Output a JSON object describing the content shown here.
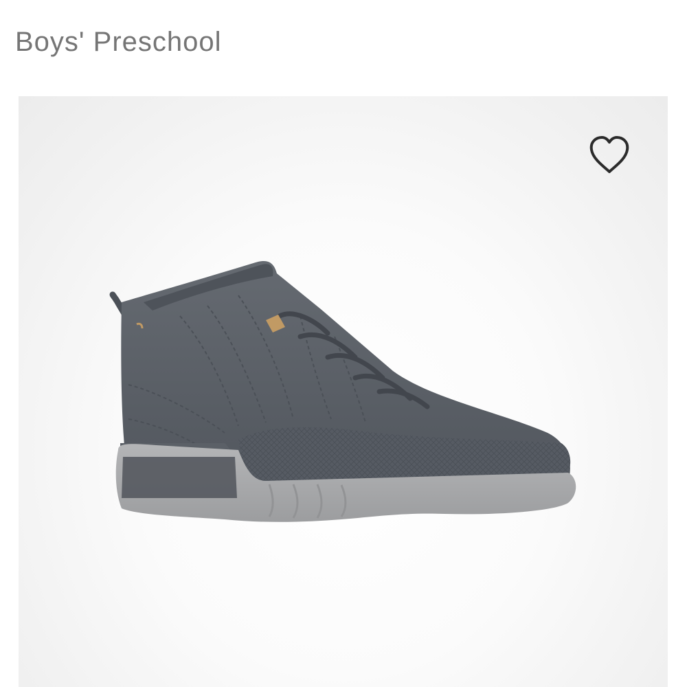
{
  "header": {
    "category_label": "Boys' Preschool"
  },
  "product": {
    "image_icon": "sneaker-image",
    "favorite_icon": "heart-outline-icon"
  },
  "colors": {
    "category_text": "#757575",
    "upper": "#5a5f66",
    "sole": "#a9aaac",
    "accent": "#c19a64"
  }
}
